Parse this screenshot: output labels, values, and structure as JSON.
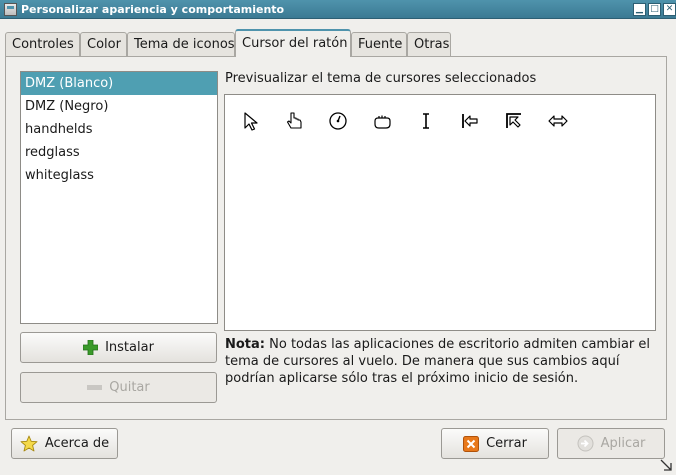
{
  "window": {
    "title": "Personalizar apariencia y comportamiento",
    "min_label": "▁",
    "max_label": "□",
    "close_label": "✕"
  },
  "tabs": [
    {
      "label": "Controles"
    },
    {
      "label": "Color"
    },
    {
      "label": "Tema de iconos"
    },
    {
      "label": "Cursor del ratón",
      "active": true
    },
    {
      "label": "Fuente"
    },
    {
      "label": "Otras"
    }
  ],
  "themes": {
    "items": [
      "DMZ (Blanco)",
      "DMZ (Negro)",
      "handhelds",
      "redglass",
      "whiteglass"
    ],
    "selected": "DMZ (Blanco)"
  },
  "buttons": {
    "install": "Instalar",
    "remove": "Quitar",
    "about": "Acerca de",
    "close": "Cerrar",
    "apply": "Aplicar"
  },
  "preview": {
    "label": "Previsualizar el tema de cursores seleccionados",
    "cursors": [
      "arrow-cursor-icon",
      "hand-cursor-icon",
      "watch-cursor-icon",
      "grab-cursor-icon",
      "text-cursor-icon",
      "left-side-cursor-icon",
      "top-left-corner-cursor-icon",
      "horizontal-resize-cursor-icon"
    ]
  },
  "note": {
    "bold": "Nota:",
    "text": " No todas las aplicaciones de escritorio admiten cambiar el tema de cursores al vuelo. De manera que sus cambios aquí podrían aplicarse sólo tras el próximo inicio de sesión."
  },
  "colors": {
    "titlebar": "#3b7a93",
    "selection": "#4f9fb2",
    "install_icon": "#3a9a2a",
    "close_icon": "#e06a10"
  }
}
